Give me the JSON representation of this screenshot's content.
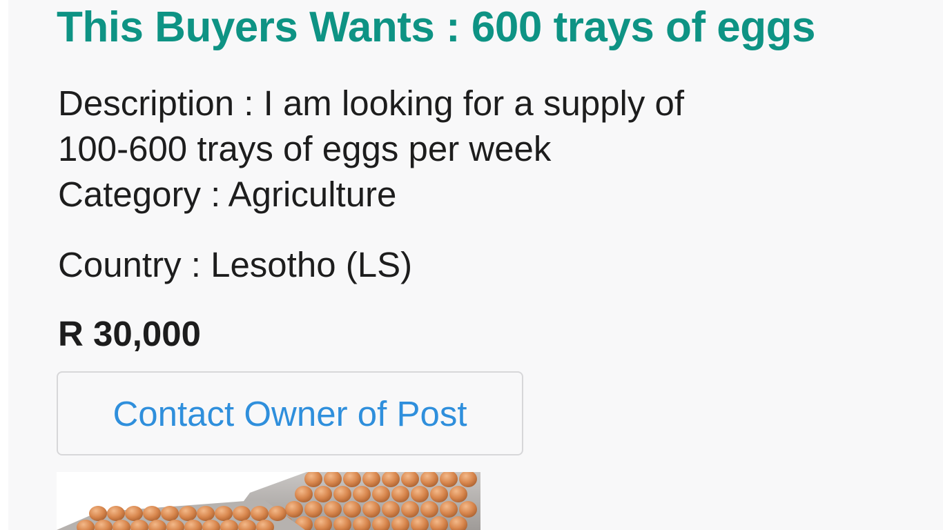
{
  "post": {
    "title": "This Buyers Wants : 600 trays of eggs",
    "description_line_1": "Description : I am looking for a supply of",
    "description_line_2": "100-600 trays of eggs per week",
    "category": "Category : Agriculture",
    "country": "Country : Lesotho (LS)",
    "price": "R 30,000",
    "contact_button_label": "Contact Owner of Post",
    "image_icon": "eggs-in-trays-photo"
  },
  "colors": {
    "title": "#0e9384",
    "text": "#1d1d1d",
    "link": "#2f8fdc",
    "card_background": "#f8f8f9",
    "button_border": "#d7d7d9"
  }
}
